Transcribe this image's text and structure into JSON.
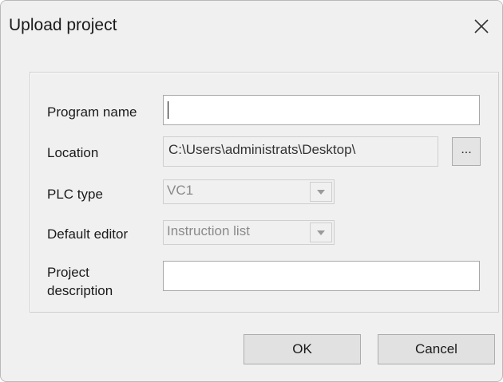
{
  "window": {
    "title": "Upload project",
    "close_icon": "close-icon"
  },
  "form": {
    "program_name": {
      "label": "Program name",
      "value": ""
    },
    "location": {
      "label": "Location",
      "value": "C:\\Users\\administrats\\Desktop\\",
      "browse_label": "..."
    },
    "plc_type": {
      "label": "PLC type",
      "value": "VC1"
    },
    "default_editor": {
      "label": "Default editor",
      "value": "Instruction list"
    },
    "project_description": {
      "label_line1": "Project",
      "label_line2": "description",
      "value": ""
    }
  },
  "buttons": {
    "ok": "OK",
    "cancel": "Cancel"
  },
  "colors": {
    "dialog_bg": "#f0f0f0",
    "disabled_text": "#8a8a8a",
    "button_bg": "#e1e1e1"
  }
}
